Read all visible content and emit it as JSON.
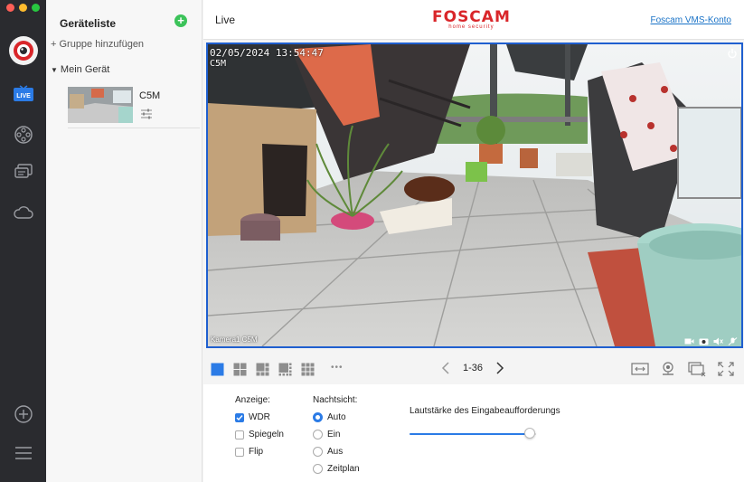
{
  "window": {
    "traffic_colors": [
      "#fe5f57",
      "#febc2e",
      "#28c840"
    ]
  },
  "rail": {
    "items": [
      {
        "name": "logo"
      },
      {
        "name": "live",
        "label": "LIVE"
      },
      {
        "name": "playback"
      },
      {
        "name": "messages"
      },
      {
        "name": "cloud"
      },
      {
        "name": "add"
      },
      {
        "name": "menu"
      }
    ]
  },
  "device_panel": {
    "title": "Geräteliste",
    "add_group": "+ Gruppe hinzufügen",
    "group_name": "Mein Gerät",
    "devices": [
      {
        "name": "C5M"
      }
    ]
  },
  "header": {
    "title": "Live",
    "brand": "FOSCAM",
    "brand_sub": "home security",
    "account_link": "Foscam VMS-Konto"
  },
  "video": {
    "timestamp": "02/05/2024 13:54:47",
    "overlay_name": "C5M",
    "channel_label": "Kamera1 C5M"
  },
  "toolbar": {
    "page_range": "1-36",
    "more": "•••"
  },
  "settings": {
    "display_title": "Anzeige:",
    "display_options": [
      {
        "label": "WDR",
        "checked": true
      },
      {
        "label": "Spiegeln",
        "checked": false
      },
      {
        "label": "Flip",
        "checked": false
      }
    ],
    "night_title": "Nachtsicht:",
    "night_options": [
      {
        "label": "Auto",
        "selected": true
      },
      {
        "label": "Ein",
        "selected": false
      },
      {
        "label": "Aus",
        "selected": false
      },
      {
        "label": "Zeitplan",
        "selected": false
      }
    ],
    "volume_label": "Lautstärke des Eingabeaufforderungs",
    "volume_level": 0.95
  },
  "colors": {
    "accent": "#2b7be6",
    "brand_red": "#d9262a",
    "add_green": "#3cc35a",
    "rail_bg": "#2a2b2f"
  }
}
